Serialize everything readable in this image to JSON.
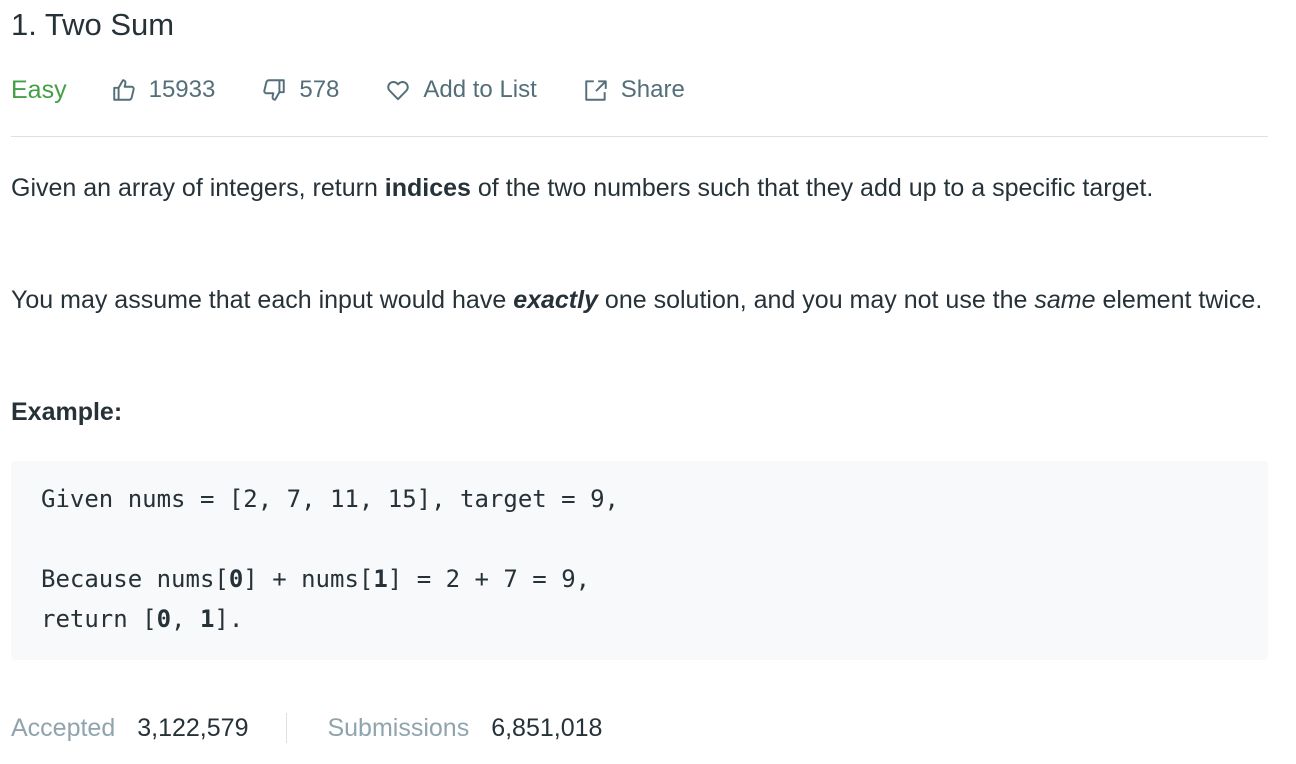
{
  "problem": {
    "title": "1. Two Sum",
    "difficulty": "Easy"
  },
  "actions": {
    "likes": "15933",
    "dislikes": "578",
    "add_to_list": "Add to List",
    "share": "Share"
  },
  "description": {
    "p1_a": "Given an array of integers, return ",
    "p1_b": "indices",
    "p1_c": " of the two numbers such that they add up to a specific target.",
    "p2_a": "You may assume that each input would have ",
    "p2_b": "exactly",
    "p2_c": " one solution, and you may not use the ",
    "p2_d": "same",
    "p2_e": " element twice."
  },
  "example": {
    "label": "Example:",
    "line1": "Given nums = [2, 7, 11, 15], target = 9,",
    "line2_a": "Because nums[",
    "line2_b": "0",
    "line2_c": "] + nums[",
    "line2_d": "1",
    "line2_e": "] = 2 + 7 = 9,",
    "line3_a": "return [",
    "line3_b": "0",
    "line3_c": ", ",
    "line3_d": "1",
    "line3_e": "]."
  },
  "stats": {
    "accepted_label": "Accepted",
    "accepted_value": "3,122,579",
    "submissions_label": "Submissions",
    "submissions_value": "6,851,018"
  },
  "colors": {
    "easy": "#43a047",
    "muted": "#546e7a",
    "label": "#90a4ae",
    "code_bg": "#f7f9fa"
  },
  "icons": {
    "like": "thumbs-up-icon",
    "dislike": "thumbs-down-icon",
    "add_to_list": "heart-icon",
    "share": "share-icon"
  }
}
